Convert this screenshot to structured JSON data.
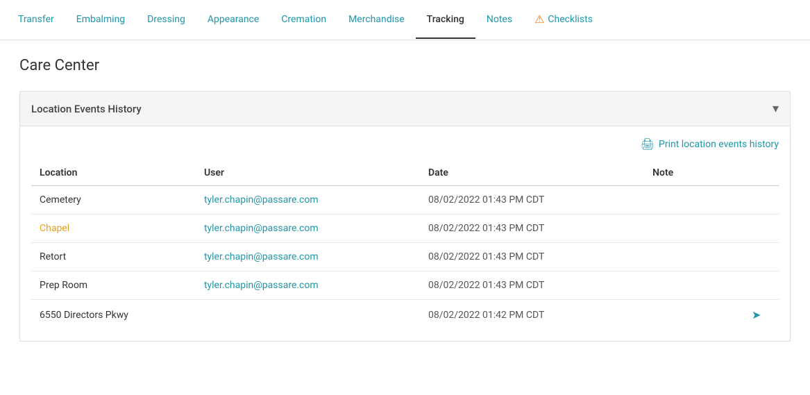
{
  "tabs": [
    {
      "id": "transfer",
      "label": "Transfer",
      "active": false,
      "alert": false
    },
    {
      "id": "embalming",
      "label": "Embalming",
      "active": false,
      "alert": false
    },
    {
      "id": "dressing",
      "label": "Dressing",
      "active": false,
      "alert": false
    },
    {
      "id": "appearance",
      "label": "Appearance",
      "active": false,
      "alert": false
    },
    {
      "id": "cremation",
      "label": "Cremation",
      "active": false,
      "alert": false
    },
    {
      "id": "merchandise",
      "label": "Merchandise",
      "active": false,
      "alert": false
    },
    {
      "id": "tracking",
      "label": "Tracking",
      "active": true,
      "alert": false
    },
    {
      "id": "notes",
      "label": "Notes",
      "active": false,
      "alert": false
    },
    {
      "id": "checklists",
      "label": "Checklists",
      "active": false,
      "alert": true
    }
  ],
  "page_title": "Care Center",
  "section": {
    "title": "Location Events History",
    "print_label": "Print location events history",
    "table": {
      "columns": [
        {
          "id": "location",
          "label": "Location"
        },
        {
          "id": "user",
          "label": "User"
        },
        {
          "id": "date",
          "label": "Date"
        },
        {
          "id": "note",
          "label": "Note"
        },
        {
          "id": "action",
          "label": ""
        }
      ],
      "rows": [
        {
          "location": "Cemetery",
          "location_link": false,
          "user": "tyler.chapin@passare.com",
          "date": "08/02/2022 01:43 PM CDT",
          "note": "",
          "has_action": false
        },
        {
          "location": "Chapel",
          "location_link": true,
          "user": "tyler.chapin@passare.com",
          "date": "08/02/2022 01:43 PM CDT",
          "note": "",
          "has_action": false
        },
        {
          "location": "Retort",
          "location_link": false,
          "user": "tyler.chapin@passare.com",
          "date": "08/02/2022 01:43 PM CDT",
          "note": "",
          "has_action": false
        },
        {
          "location": "Prep Room",
          "location_link": false,
          "user": "tyler.chapin@passare.com",
          "date": "08/02/2022 01:43 PM CDT",
          "note": "",
          "has_action": false
        },
        {
          "location": "6550 Directors Pkwy",
          "location_link": false,
          "user": "",
          "date": "08/02/2022 01:42 PM CDT",
          "note": "",
          "has_action": true
        }
      ]
    }
  },
  "colors": {
    "accent": "#2196a8",
    "link_orange": "#e6a020",
    "alert_orange": "#f57c00"
  }
}
